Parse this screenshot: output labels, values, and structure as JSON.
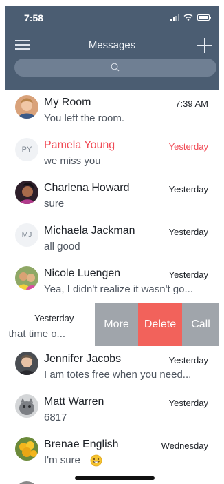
{
  "status_bar": {
    "time": "7:58"
  },
  "header": {
    "title": "Messages"
  },
  "colors": {
    "header": "#4b5d72",
    "unread": "#f04a55",
    "delete": "#f2625b",
    "action_gray": "#a0a5ab"
  },
  "conversations": [
    {
      "name": "My Room",
      "time": "7:39 AM",
      "preview": "You left the room.",
      "avatar": "photo"
    },
    {
      "name": "Pamela Young",
      "time": "Yesterday",
      "preview": "we miss you",
      "avatar": "PY",
      "unread": true
    },
    {
      "name": "Charlena Howard",
      "time": "Yesterday",
      "preview": "sure",
      "avatar": "photo"
    },
    {
      "name": "Michaela Jackman",
      "time": "Yesterday",
      "preview": "all good",
      "avatar": "MJ"
    },
    {
      "name": "Nicole Luengen",
      "time": "Yesterday",
      "preview": "Yea, I didn't realize it wasn't go...",
      "avatar": "photo"
    },
    {
      "name": "",
      "time": "Yesterday",
      "preview": "o that time o...",
      "swiped": true
    },
    {
      "name": "Jennifer Jacobs",
      "time": "Yesterday",
      "preview": "I am totes free when you need...",
      "avatar": "photo"
    },
    {
      "name": "Matt Warren",
      "time": "Yesterday",
      "preview": "6817",
      "avatar": "photo"
    },
    {
      "name": "Brenae English",
      "time": "Wednesday",
      "preview": "I'm sure",
      "avatar": "photo"
    }
  ],
  "swipe_actions": {
    "more": "More",
    "delete": "Delete",
    "call": "Call"
  },
  "icons": [
    "menu-icon",
    "plus-icon",
    "search-icon",
    "signal-icon",
    "wifi-icon",
    "battery-icon",
    "grin-emoji-icon"
  ]
}
